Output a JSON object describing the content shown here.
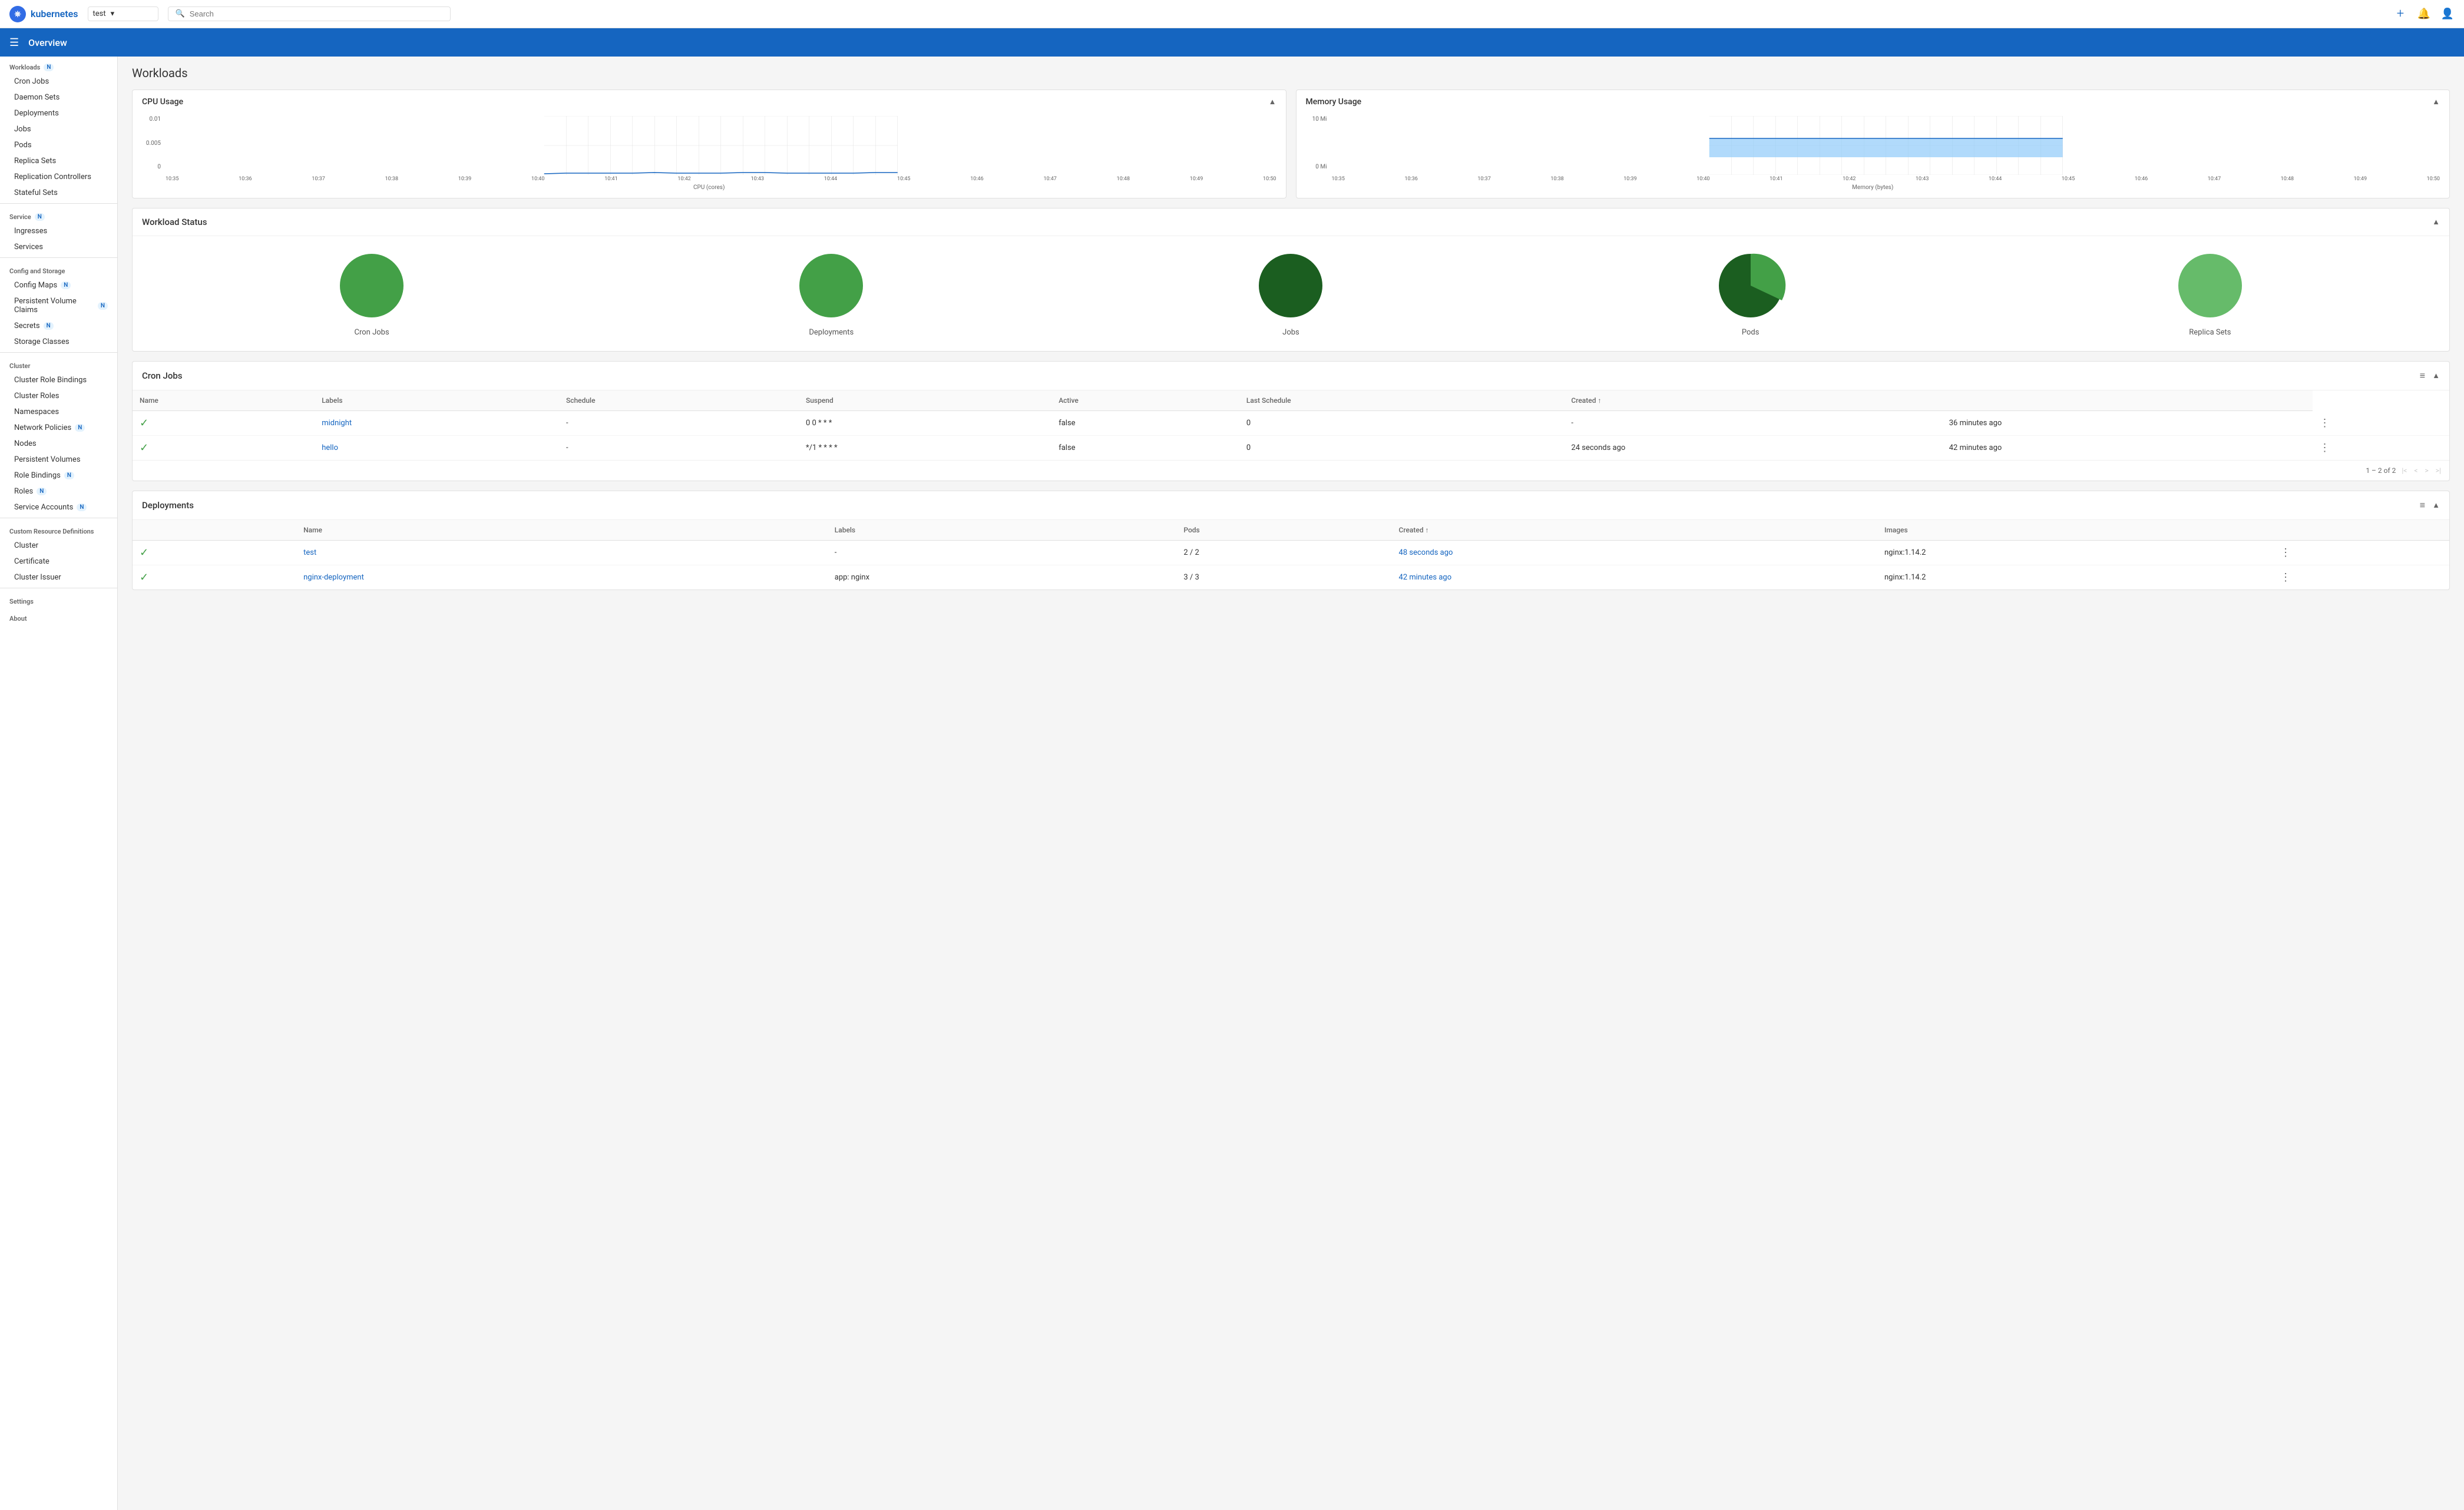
{
  "topbar": {
    "logo_text": "kubernetes",
    "namespace": "test",
    "search_placeholder": "Search",
    "add_label": "+",
    "bell_label": "🔔",
    "user_label": "👤"
  },
  "header": {
    "title": "Overview"
  },
  "sidebar": {
    "workloads_label": "Workloads",
    "workloads_badge": "N",
    "cron_jobs": "Cron Jobs",
    "daemon_sets": "Daemon Sets",
    "deployments": "Deployments",
    "jobs": "Jobs",
    "pods": "Pods",
    "replica_sets": "Replica Sets",
    "replication_controllers": "Replication Controllers",
    "stateful_sets": "Stateful Sets",
    "service_label": "Service",
    "service_badge": "N",
    "ingresses": "Ingresses",
    "services": "Services",
    "config_storage_label": "Config and Storage",
    "config_maps": "Config Maps",
    "config_maps_badge": "N",
    "pvc": "Persistent Volume Claims",
    "pvc_badge": "N",
    "secrets": "Secrets",
    "secrets_badge": "N",
    "storage_classes": "Storage Classes",
    "cluster_label": "Cluster",
    "cluster_role_bindings": "Cluster Role Bindings",
    "cluster_roles": "Cluster Roles",
    "namespaces": "Namespaces",
    "network_policies": "Network Policies",
    "network_policies_badge": "N",
    "nodes": "Nodes",
    "persistent_volumes": "Persistent Volumes",
    "role_bindings": "Role Bindings",
    "role_bindings_badge": "N",
    "roles": "Roles",
    "roles_badge": "N",
    "service_accounts": "Service Accounts",
    "service_accounts_badge": "N",
    "crd_label": "Custom Resource Definitions",
    "crd_cluster": "Cluster",
    "crd_certificate": "Certificate",
    "crd_cluster_issuer": "Cluster Issuer",
    "settings_label": "Settings",
    "about_label": "About"
  },
  "content": {
    "title": "Workloads"
  },
  "cpu_chart": {
    "title": "CPU Usage",
    "y_label": "CPU (cores)",
    "y_ticks": [
      "0.01",
      "0.005",
      "0"
    ],
    "x_ticks": [
      "10:35",
      "10:36",
      "10:37",
      "10:38",
      "10:39",
      "10:40",
      "10:41",
      "10:42",
      "10:43",
      "10:44",
      "10:45",
      "10:46",
      "10:47",
      "10:48",
      "10:49",
      "10:50"
    ]
  },
  "memory_chart": {
    "title": "Memory Usage",
    "y_label": "Memory (bytes)",
    "y_ticks": [
      "10 Mi",
      "0 Mi"
    ],
    "x_ticks": [
      "10:35",
      "10:36",
      "10:37",
      "10:38",
      "10:39",
      "10:40",
      "10:41",
      "10:42",
      "10:43",
      "10:44",
      "10:45",
      "10:46",
      "10:47",
      "10:48",
      "10:49",
      "10:50"
    ]
  },
  "workload_status": {
    "title": "Workload Status",
    "items": [
      {
        "label": "Cron Jobs",
        "type": "full_green"
      },
      {
        "label": "Deployments",
        "type": "full_green"
      },
      {
        "label": "Jobs",
        "type": "full_dark"
      },
      {
        "label": "Pods",
        "type": "partial"
      },
      {
        "label": "Replica Sets",
        "type": "full_green_light"
      }
    ]
  },
  "cron_jobs": {
    "title": "Cron Jobs",
    "columns": [
      "Name",
      "Labels",
      "Schedule",
      "Suspend",
      "Active",
      "Last Schedule",
      "Created"
    ],
    "rows": [
      {
        "name": "midnight",
        "labels": "-",
        "schedule": "0 0 * * *",
        "suspend": "false",
        "active": "0",
        "last_schedule": "-",
        "created": "36 minutes ago"
      },
      {
        "name": "hello",
        "labels": "-",
        "schedule": "*/1 * * * *",
        "suspend": "false",
        "active": "0",
        "last_schedule": "24 seconds ago",
        "created": "42 minutes ago"
      }
    ],
    "pagination": "1 – 2 of 2"
  },
  "deployments": {
    "title": "Deployments",
    "columns": [
      "Name",
      "Labels",
      "Pods",
      "Created",
      "Images"
    ],
    "rows": [
      {
        "name": "test",
        "labels": "-",
        "pods": "2 / 2",
        "created": "48 seconds ago",
        "images": "nginx:1.14.2"
      },
      {
        "name": "nginx-deployment",
        "labels": "app: nginx",
        "pods": "3 / 3",
        "created": "42 minutes ago",
        "images": "nginx:1.14.2"
      }
    ]
  }
}
